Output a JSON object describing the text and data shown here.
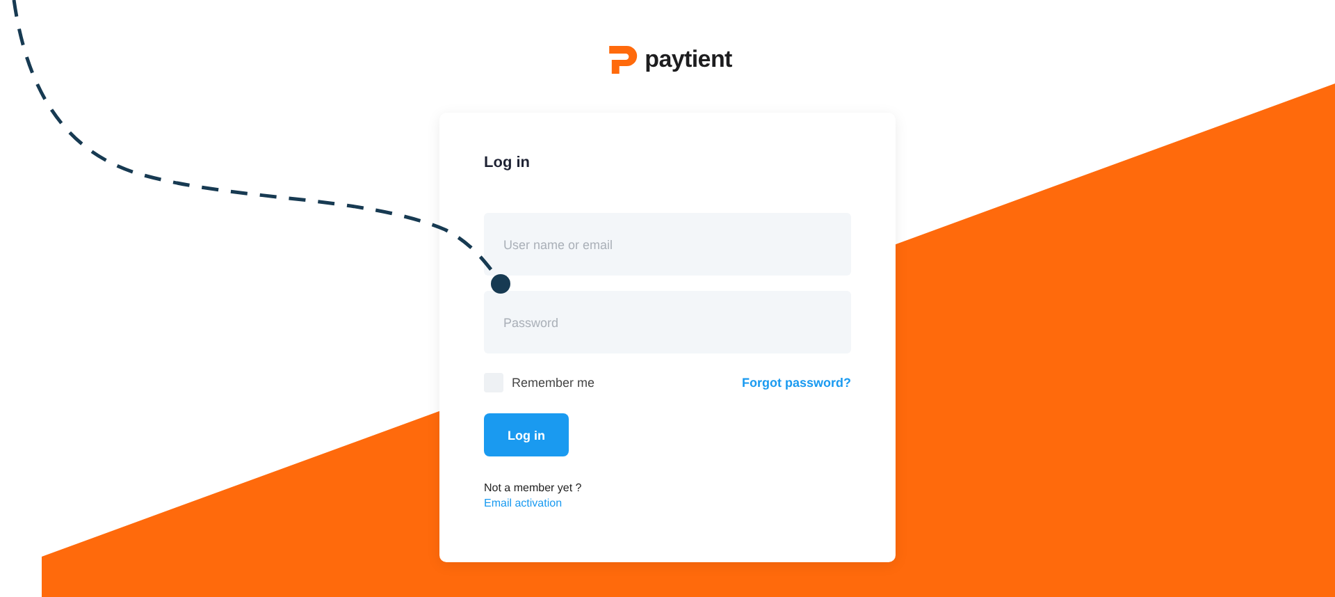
{
  "logo": {
    "text": "paytient"
  },
  "card": {
    "title": "Log in",
    "fields": [
      {
        "placeholder": "User name or email"
      },
      {
        "placeholder": "Password"
      }
    ],
    "remember": {
      "label": "Remember me",
      "checked": false
    },
    "forgot_link": "Forgot password?",
    "submit_button": "Log in",
    "signup_prompt": "Not a member yet ?",
    "signup_link": "Email activation"
  }
}
